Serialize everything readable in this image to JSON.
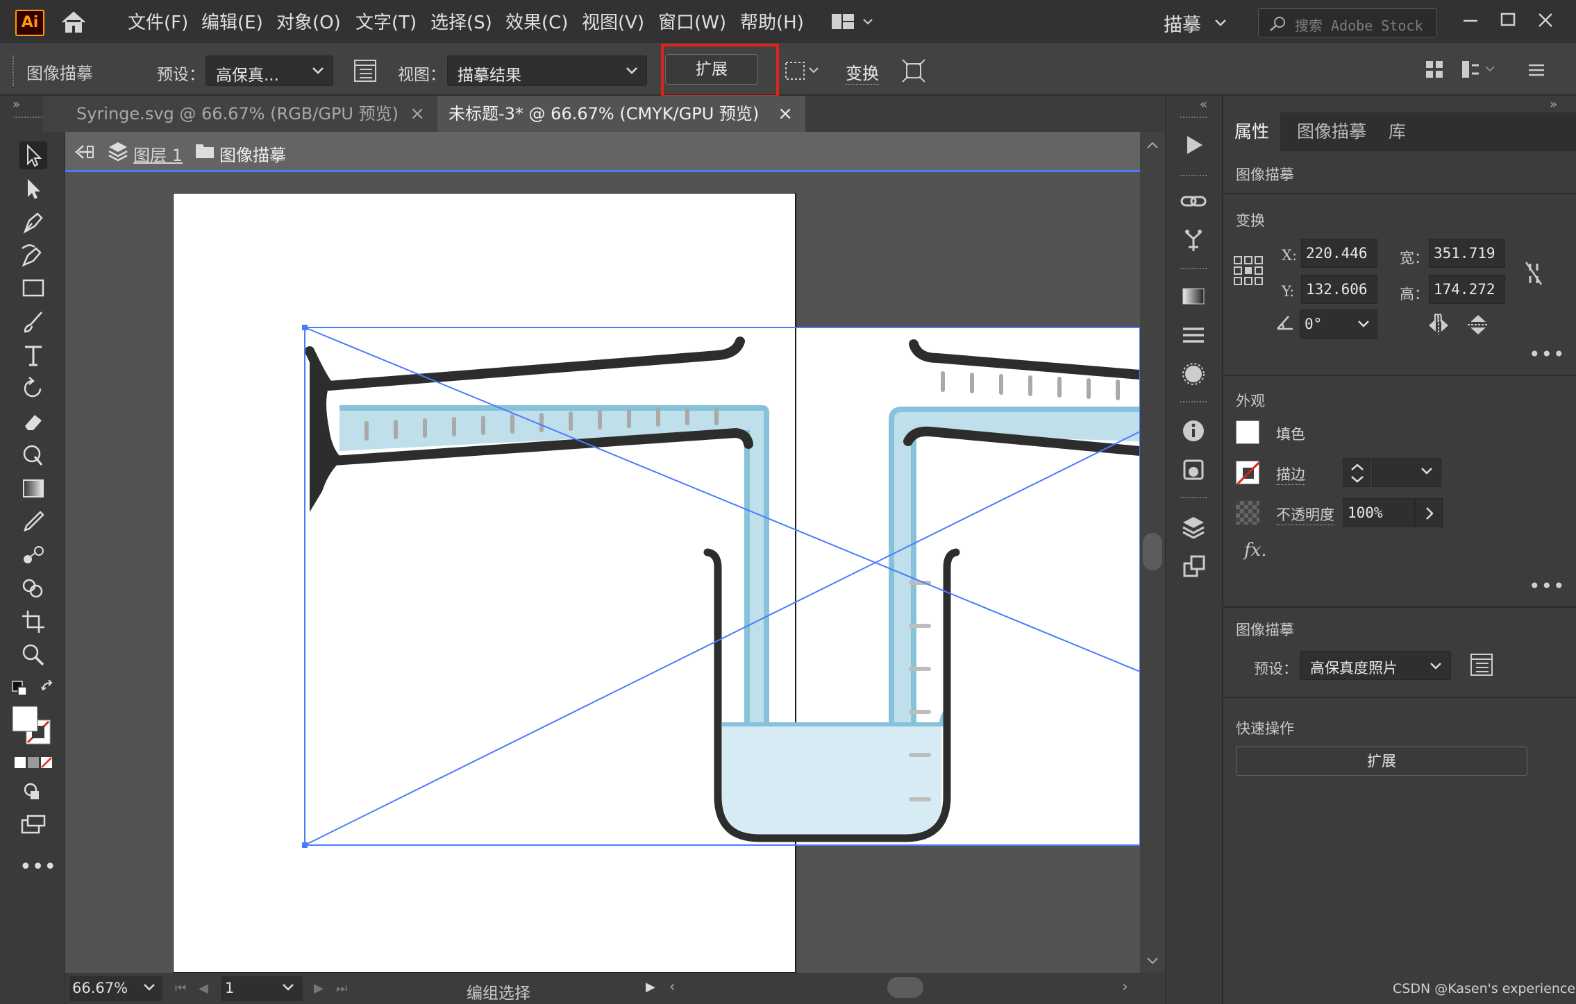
{
  "menubar": {
    "app_logo": "Ai",
    "items": [
      "文件(F)",
      "编辑(E)",
      "对象(O)",
      "文字(T)",
      "选择(S)",
      "效果(C)",
      "视图(V)",
      "窗口(W)",
      "帮助(H)"
    ],
    "workspace": "描摹",
    "search_placeholder": "搜索 Adobe Stock"
  },
  "controlbar": {
    "title": "图像描摹",
    "preset_label": "预设：",
    "preset_value": "高保真...",
    "view_label": "视图：",
    "view_value": "描摹结果",
    "expand_label": "扩展",
    "transform_label": "变换"
  },
  "tabs": [
    {
      "label": "Syringe.svg @ 66.67% (RGB/GPU 预览)",
      "active": false
    },
    {
      "label": "未标题-3* @ 66.67% (CMYK/GPU 预览)",
      "active": true
    }
  ],
  "breadcrumb": {
    "layer": "图层 1",
    "object": "图像描摹"
  },
  "statusbar": {
    "zoom": "66.67%",
    "page": "1",
    "status": "编组选择"
  },
  "panel": {
    "tabs": [
      "属性",
      "图像描摹",
      "库"
    ],
    "object_type": "图像描摹",
    "transform": {
      "title": "变换",
      "x_label": "X:",
      "x": "220.446 m",
      "y_label": "Y:",
      "y": "132.606 m",
      "w_label": "宽：",
      "w": "351.719 m",
      "h_label": "高：",
      "h": "174.272 m",
      "angle": "0°"
    },
    "appearance": {
      "title": "外观",
      "fill_label": "填色",
      "stroke_label": "描边",
      "opacity_label": "不透明度",
      "opacity_value": "100%",
      "fx_label": "fx."
    },
    "trace": {
      "title": "图像描摹",
      "preset_label": "预设：",
      "preset_value": "高保真度照片"
    },
    "quick_actions": {
      "title": "快速操作",
      "expand_label": "扩展"
    }
  },
  "colors": {
    "highlight": "#e2231a",
    "selection": "#4a7bff",
    "liquid": "#bfdfea",
    "tube_stroke": "#86c3da",
    "ink": "#2d2d2d"
  },
  "watermark": "CSDN @Kasen's experience"
}
